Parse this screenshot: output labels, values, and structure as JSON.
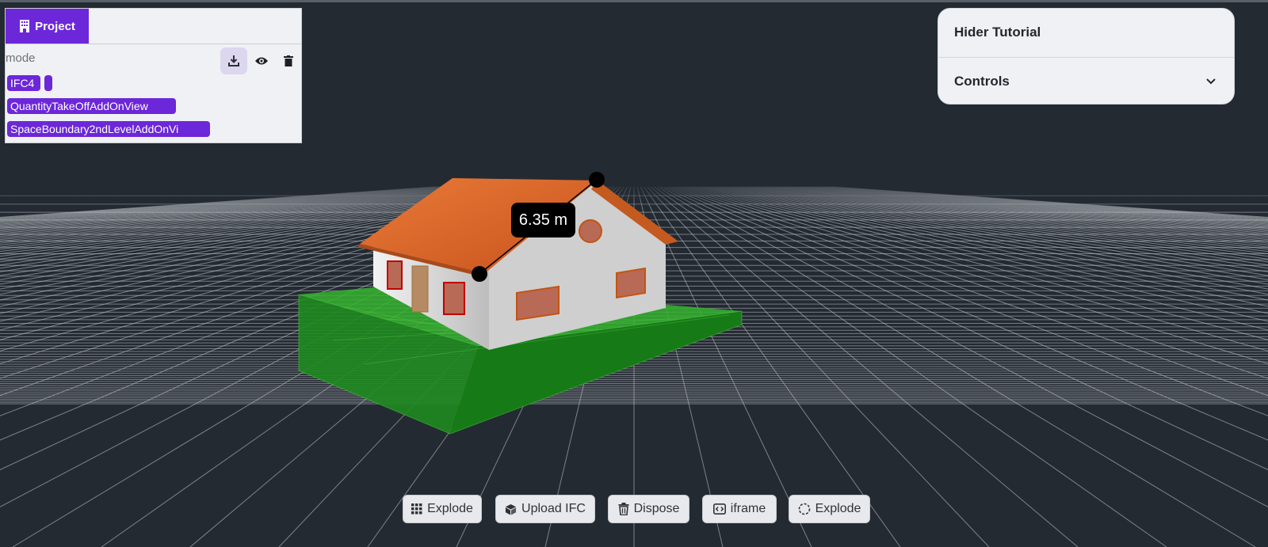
{
  "project_panel": {
    "tab_label": "Project",
    "mode_label": "mode",
    "chips": [
      "IFC4",
      "",
      "QuantityTakeOffAddOnView",
      "SpaceBoundary2ndLevelAddOnVi"
    ],
    "icons": [
      "download-icon",
      "eye-icon",
      "trash-icon"
    ]
  },
  "tutorial_panel": {
    "title": "Hider Tutorial",
    "controls_label": "Controls"
  },
  "measurement": {
    "label": "6.35 m"
  },
  "toolbar": {
    "buttons": [
      {
        "label": "Explode",
        "icon": "grid-icon"
      },
      {
        "label": "Upload IFC",
        "icon": "cube-icon"
      },
      {
        "label": "Dispose",
        "icon": "trash-icon"
      },
      {
        "label": "iframe",
        "icon": "code-icon"
      },
      {
        "label": "Explode",
        "icon": "dashed-circle-icon"
      }
    ]
  },
  "colors": {
    "accent": "#6c27d9",
    "background": "#242a32",
    "roof": "#e06a2c",
    "ground_slab": "#2ea62a",
    "walls": "#d6d6d6",
    "grid": "#c8ccd2"
  }
}
